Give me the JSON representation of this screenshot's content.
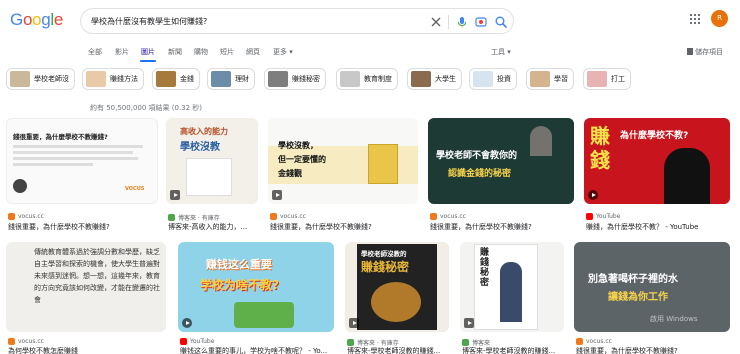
{
  "logo": {
    "letters": [
      "G",
      "o",
      "o",
      "g",
      "l",
      "e"
    ],
    "colors": [
      "#4285f4",
      "#ea4335",
      "#fbbc05",
      "#4285f4",
      "#34a853",
      "#ea4335"
    ]
  },
  "search": {
    "query": "學校為什麼沒有教學生如何賺錢?"
  },
  "avatar": {
    "initial": "R"
  },
  "tabs": [
    {
      "label": "全部"
    },
    {
      "label": "影片"
    },
    {
      "label": "圖片"
    },
    {
      "label": "新聞"
    },
    {
      "label": "購物"
    },
    {
      "label": "短片"
    },
    {
      "label": "網頁"
    },
    {
      "label": "更多 ▾"
    }
  ],
  "tools_label": "工具 ▾",
  "saved_label": "儲存項目",
  "chips": [
    {
      "label": "學校老師沒",
      "color": "#c9b99a"
    },
    {
      "label": "賺錢方法",
      "color": "#e8c9a8"
    },
    {
      "label": "金錢",
      "color": "#a57a3c"
    },
    {
      "label": "理財",
      "color": "#6c8ca8"
    },
    {
      "label": "賺錢秘密",
      "color": "#7e7e7e"
    },
    {
      "label": "教育制度",
      "color": "#c8c8c8"
    },
    {
      "label": "大學生",
      "color": "#8a6b4e"
    },
    {
      "label": "投資",
      "color": "#d6e4f0"
    },
    {
      "label": "學習",
      "color": "#d4b38f"
    },
    {
      "label": "打工",
      "color": "#e7b3b3"
    }
  ],
  "result_stats": "約有 50,500,000 項結果 (0.32 秒)",
  "row1": [
    {
      "source": "vocus.cc",
      "title": "錢很重要，為什麼學校不教賺錢?",
      "img_title": "錢很重要，為什麼學校不教賺錢?",
      "img_brand": "VOCUS"
    },
    {
      "source": "博客來 · 有庫存",
      "title": "博客來-高收入的能力，...",
      "img_line1": "高收入的能力",
      "img_line2": "學校沒教"
    },
    {
      "source": "vocus.cc",
      "title": "錢很重要，為什麼學校不教賺錢?",
      "img_line1": "學校沒教，",
      "img_line2": "但一定要懂的",
      "img_line3": "金錢觀"
    },
    {
      "source": "vocus.cc",
      "title": "錢很重要，為什麼學校不教賺錢?",
      "img_line1": "學校老師不會教你的",
      "img_line2": "認識金錢的秘密"
    },
    {
      "source": "YouTube",
      "title": "賺錢，為什麼學校不教？ - YouTube",
      "img_line1": "賺",
      "img_line2": "錢",
      "img_line3": "為什麼學校不教?"
    }
  ],
  "row2": [
    {
      "source": "vocus.cc",
      "title": "為何學校不教怎麼賺錢",
      "img_text": "傳統教育體系過於強調分數和學歷，缺乏自主學習和探索的機會，使大學生普遍對未來感到迷惘。想一想，這幾年來，教育的方向究竟該如何改變，才能在變遷的社會"
    },
    {
      "source": "YouTube",
      "title": "賺钱这么重要的事儿，学校为啥不教呢？ - Yo...",
      "img_line1": "赚钱这么重要",
      "img_line2": "学校为啥不教?"
    },
    {
      "source": "博客來 · 有庫存",
      "title": "博客來-學校老師沒教的賺錢...",
      "img_line1": "學校老師沒教的",
      "img_line2": "賺錢秘密"
    },
    {
      "source": "博客來",
      "title": "博客來-學校老師沒教的賺錢...",
      "img_line1": "賺錢秘密"
    },
    {
      "source": "vocus.cc",
      "title": "錢很重要，為什麼學校不教賺錢?",
      "img_line1": "別急著喝杯子裡的水",
      "img_line2": "讓錢為你工作",
      "img_overlay": "啟用 Windows"
    }
  ]
}
